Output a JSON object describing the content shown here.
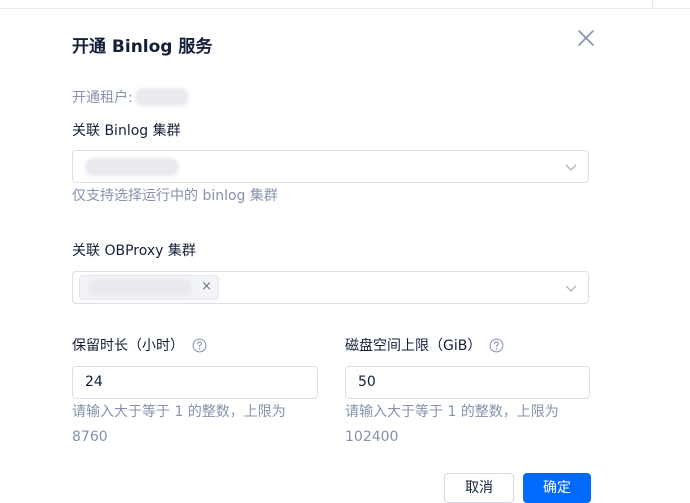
{
  "dialog": {
    "title": "开通 Binlog 服务",
    "tenant_label": "开通租户:",
    "binlog_cluster": {
      "label": "关联 Binlog 集群",
      "help": "仅支持选择运行中的 binlog 集群"
    },
    "obproxy_cluster": {
      "label": "关联 OBProxy 集群",
      "tag_remove": "×"
    },
    "retention": {
      "label": "保留时长（小时）",
      "value": "24",
      "help_line1": "请输入大于等于 1 的整数，上限为",
      "help_line2": "8760"
    },
    "disk_limit": {
      "label": "磁盘空间上限（GiB）",
      "value": "50",
      "help_line1": "请输入大于等于 1 的整数，上限为",
      "help_line2": "102400"
    },
    "footer": {
      "cancel_label": "取消",
      "ok_label": "确定"
    }
  },
  "colors": {
    "primary": "#006aff",
    "text": "#132039",
    "muted": "#8592ad",
    "border": "#dcdfe6"
  },
  "icons": [
    "close-icon",
    "chevron-down-icon",
    "question-circle-icon"
  ]
}
